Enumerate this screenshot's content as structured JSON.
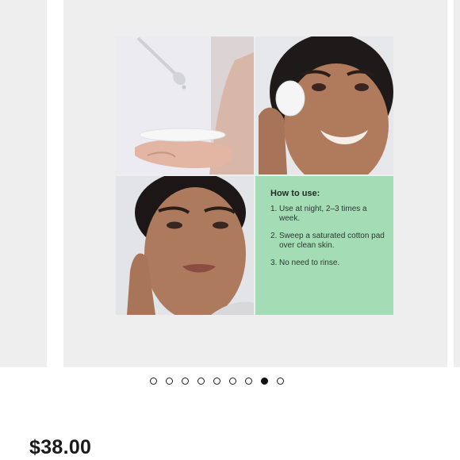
{
  "carousel": {
    "how_to_use": {
      "title": "How to use:",
      "steps": [
        {
          "num": "1.",
          "text": "Use at night, 2–3 times a week."
        },
        {
          "num": "2.",
          "text": "Sweep a saturated cotton pad over clean skin."
        },
        {
          "num": "3.",
          "text": "No need to rinse."
        }
      ]
    },
    "dot_count": 9,
    "active_dot": 8
  },
  "product": {
    "price": "$38.00"
  },
  "colors": {
    "slide_bg": "#eeeeee",
    "how_to_panel": "#a3dcb5",
    "active_dot": "#111111"
  }
}
